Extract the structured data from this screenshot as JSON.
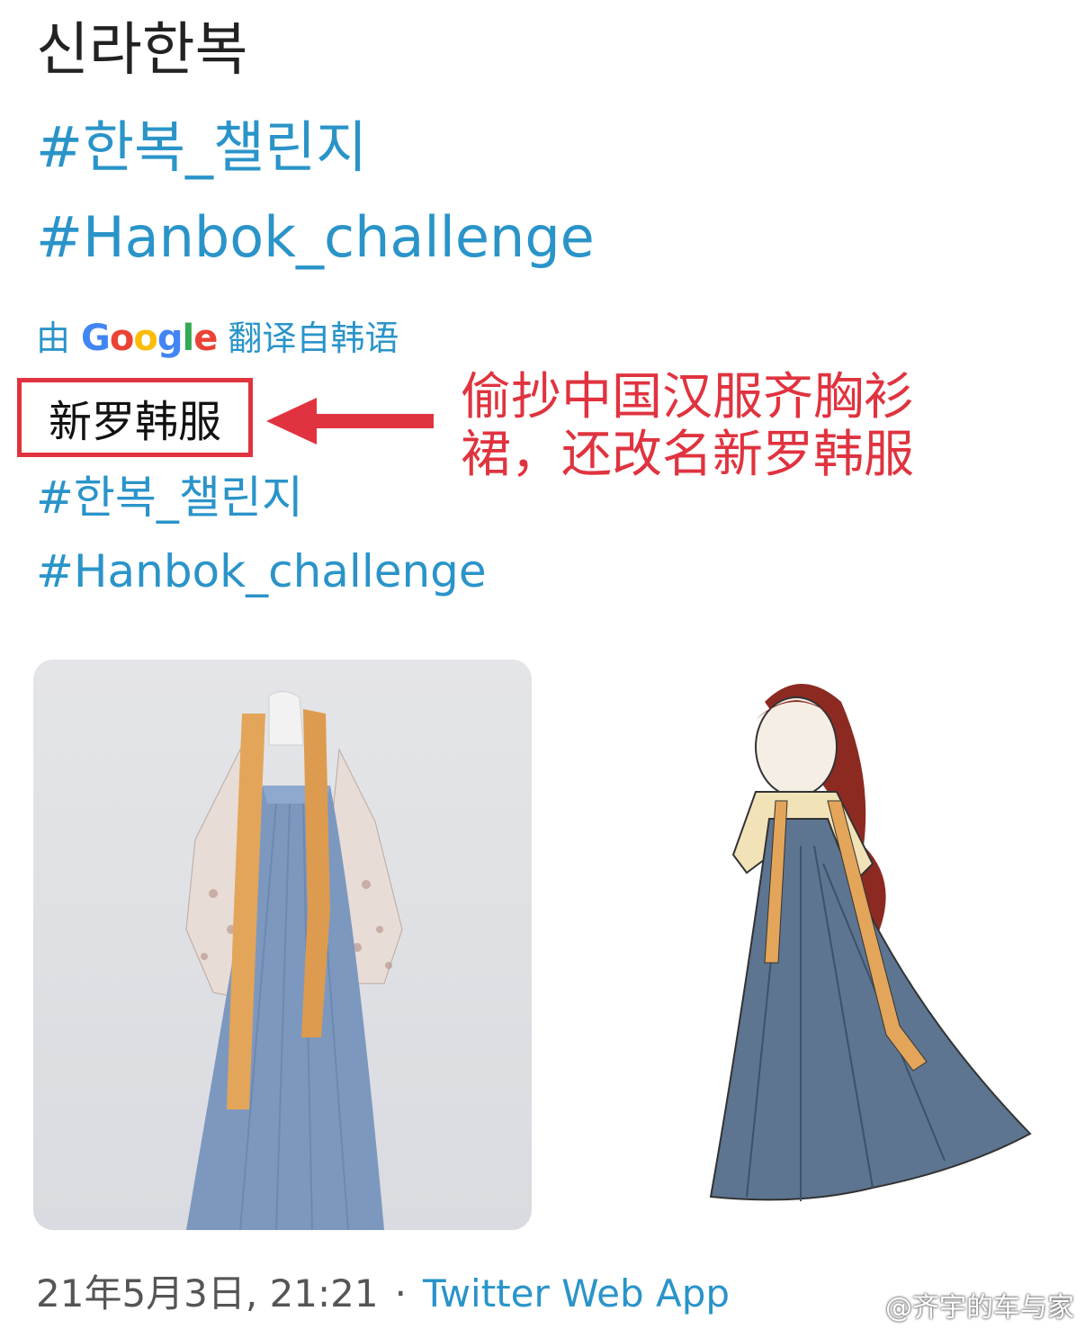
{
  "post": {
    "title": "신라한복",
    "hashtag_ko": "#한복_챌린지",
    "hashtag_en": "#Hanbok_challenge"
  },
  "translation": {
    "prefix": "由",
    "google": [
      "G",
      "o",
      "o",
      "g",
      "l",
      "e"
    ],
    "suffix": "翻译自韩语",
    "text": "新罗韩服",
    "hashtag_ko": "#한복_챌린지",
    "hashtag_en": "#Hanbok_challenge"
  },
  "annotation": {
    "text": "偷抄中国汉服齐胸衫裙，还改名新罗韩服",
    "color": "#e0333f"
  },
  "footer": {
    "date": "21年5月3日, 21:21",
    "separator": "·",
    "source": "Twitter Web App"
  },
  "watermark": {
    "text": "@齐宇的车与家",
    "icon": "weibo-icon"
  },
  "colors": {
    "link": "#2a94c9",
    "highlight": "#e0333f"
  }
}
